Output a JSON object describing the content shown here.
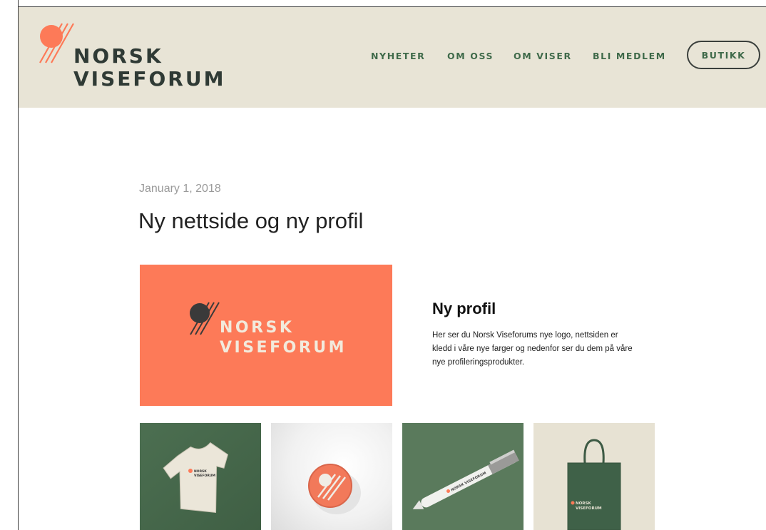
{
  "site": {
    "logo_line1": "NORSK",
    "logo_line2": "VISEFORUM",
    "brand_colors": {
      "coral": "#fd7a58",
      "green": "#3f6a4a",
      "beige": "#e8e4d6",
      "dark": "#2f3a35"
    }
  },
  "nav": {
    "items": [
      {
        "label": "NYHETER"
      },
      {
        "label": "OM OSS"
      },
      {
        "label": "OM VISER"
      },
      {
        "label": "BLI MEDLEM"
      }
    ],
    "shop_label": "BUTIKK"
  },
  "post": {
    "date": "January 1, 2018",
    "title": "Ny nettside og ny profil",
    "hero_logo_line1": "NORSK",
    "hero_logo_line2": "VISEFORUM",
    "profile_heading": "Ny profil",
    "profile_text": "Her ser du Norsk Viseforums nye logo, nettsiden er kledd i våre nye farger og nedenfor ser du dem på våre nye profileringsprodukter."
  },
  "gallery": {
    "items": [
      {
        "name": "t-shirt",
        "icon": "tshirt-icon",
        "print_line1": "NORSK",
        "print_line2": "VISEFORUM"
      },
      {
        "name": "badge",
        "icon": "badge-icon"
      },
      {
        "name": "pen",
        "icon": "pen-icon",
        "print": "NORSK VISEFORUM"
      },
      {
        "name": "tote-bag",
        "icon": "tote-bag-icon",
        "print_line1": "NORSK",
        "print_line2": "VISEFORUM"
      }
    ]
  }
}
